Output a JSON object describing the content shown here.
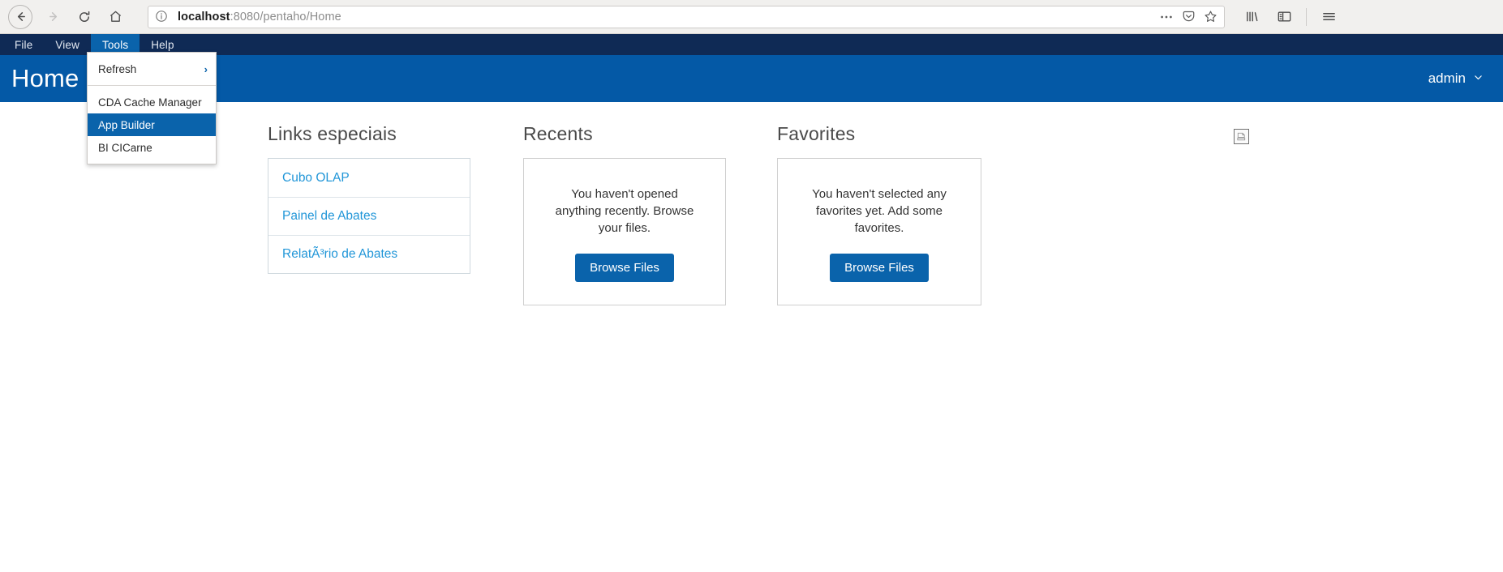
{
  "browser": {
    "back_icon": "back-arrow-icon",
    "forward_icon": "forward-arrow-icon",
    "reload_icon": "reload-icon",
    "home_icon": "home-icon",
    "url_host": "localhost",
    "url_rest": ":8080/pentaho/Home",
    "url_full": "localhost:8080/pentaho/Home",
    "info_icon": "page-info-icon",
    "more_icon": "ellipsis-icon",
    "pocket_icon": "pocket-save-icon",
    "bookmark_icon": "star-bookmark-icon",
    "library_icon": "library-icon",
    "sidebar_icon": "sidebar-toggle-icon",
    "menu_icon": "hamburger-menu-icon"
  },
  "menubar": {
    "items": [
      {
        "label": "File",
        "active": false
      },
      {
        "label": "View",
        "active": false
      },
      {
        "label": "Tools",
        "active": true
      },
      {
        "label": "Help",
        "active": false
      }
    ]
  },
  "dropdown": {
    "groups": [
      {
        "items": [
          {
            "label": "Refresh",
            "submenu": true,
            "selected": false,
            "arrow": "›"
          }
        ]
      },
      {
        "items": [
          {
            "label": "CDA Cache Manager",
            "submenu": false,
            "selected": false
          },
          {
            "label": "App Builder",
            "submenu": false,
            "selected": true
          },
          {
            "label": "BI CICarne",
            "submenu": false,
            "selected": false
          }
        ]
      }
    ]
  },
  "header": {
    "title": "Home",
    "title_chevron": "chevron-down-icon",
    "user": "admin",
    "user_chevron": "chevron-down-icon"
  },
  "panels": {
    "links": {
      "title": "Links especiais",
      "items": [
        {
          "label": "Cubo OLAP"
        },
        {
          "label": "Painel de Abates"
        },
        {
          "label": "RelatÃ³rio de Abates"
        }
      ]
    },
    "recents": {
      "title": "Recents",
      "empty_text": "You haven't opened anything recently. Browse your files.",
      "button": "Browse Files"
    },
    "favorites": {
      "title": "Favorites",
      "empty_text": "You haven't selected any favorites yet. Add some favorites.",
      "button": "Browse Files"
    }
  },
  "misc": {
    "broken_image_icon": "broken-image-icon"
  },
  "colors": {
    "menubar_bg": "#0f2a55",
    "header_bg": "#0459a6",
    "accent": "#0a63ab",
    "link": "#2196d8",
    "chrome_bg": "#f1f0ee"
  }
}
